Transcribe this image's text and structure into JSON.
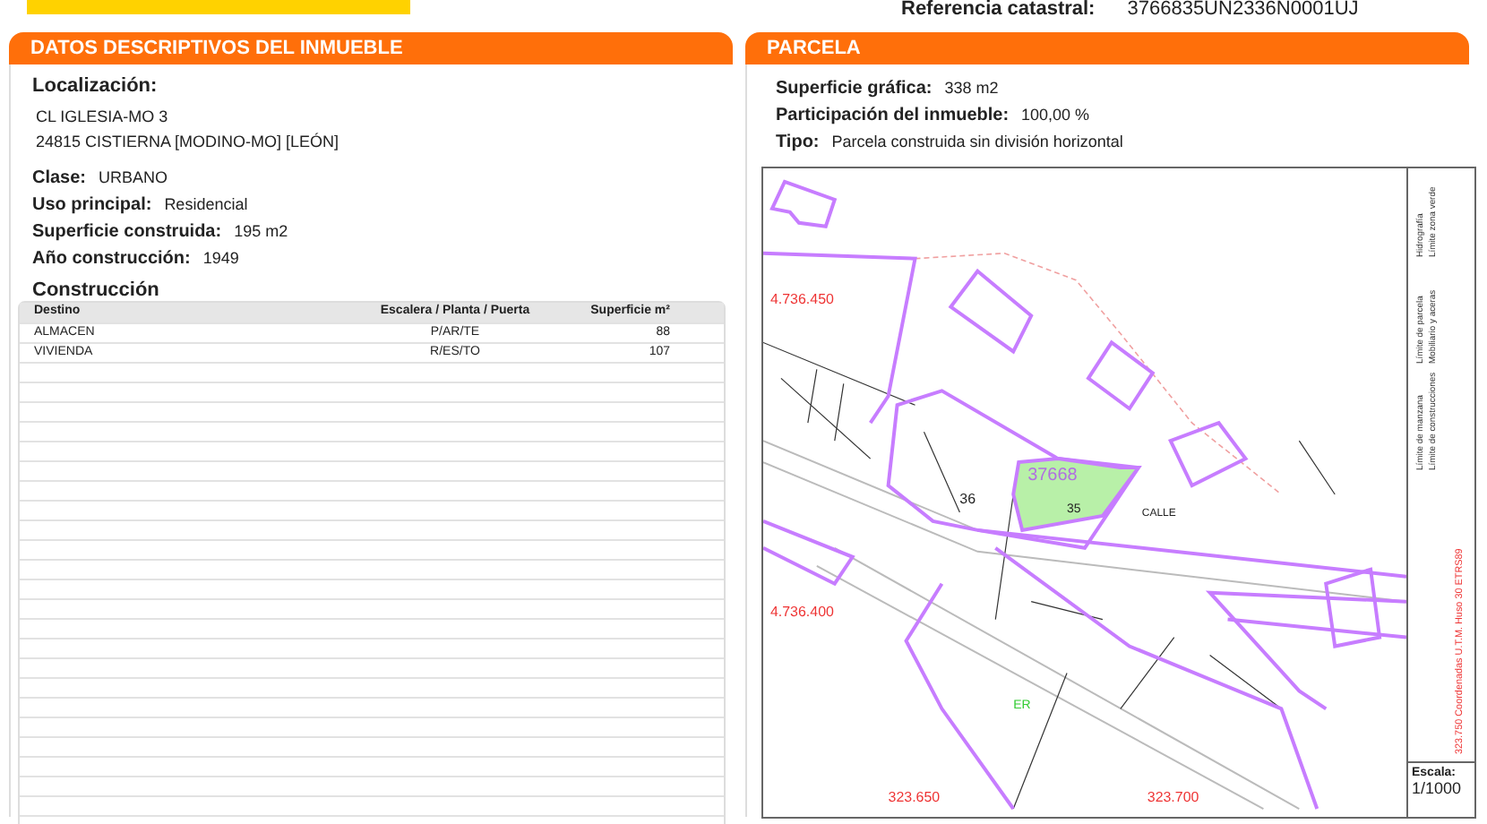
{
  "reference": {
    "label": "Referencia catastral:",
    "value": "3766835UN2336N0001UJ"
  },
  "left": {
    "title": "DATOS DESCRIPTIVOS DEL INMUEBLE",
    "location_label": "Localización:",
    "address": [
      "CL IGLESIA-MO 3",
      "24815 CISTIERNA [MODINO-MO] [LEÓN]"
    ],
    "fields": [
      {
        "label": "Clase:",
        "value": "URBANO"
      },
      {
        "label": "Uso principal:",
        "value": "Residencial"
      },
      {
        "label": "Superficie construida:",
        "value": "195 m2"
      },
      {
        "label": "Año construcción:",
        "value": "1949"
      }
    ],
    "construction_title": "Construcción",
    "table": {
      "columns": [
        "Destino",
        "Escalera / Planta / Puerta",
        "Superficie m²"
      ],
      "rows": [
        [
          "ALMACEN",
          "P/AR/TE",
          "88"
        ],
        [
          "VIVIENDA",
          "R/ES/TO",
          "107"
        ]
      ]
    }
  },
  "right": {
    "title": "PARCELA",
    "fields": [
      {
        "label": "Superficie gráfica:",
        "value": "338 m2"
      },
      {
        "label": "Participación del inmueble:",
        "value": "100,00 %"
      },
      {
        "label": "Tipo:",
        "value": "Parcela construida sin división horizontal"
      }
    ],
    "map": {
      "y_coords": [
        "4.736.450",
        "4.736.400"
      ],
      "x_coords": [
        "323.650",
        "323.700"
      ],
      "parcel_ref": "37668",
      "parcel_number": "35",
      "block_number": "36",
      "street": "CALLE",
      "green_label": "ER",
      "legend": [
        "Límite de manzana",
        "Límite de construcciones",
        "Límite de parcela",
        "Mobiliario y aceras",
        "Hidrografía",
        "Límite zona verde"
      ],
      "crs_note": "323.750 Coordenadas U.T.M. Huso 30 ETRS89",
      "scale_label": "Escala:",
      "scale": "1/1000"
    }
  }
}
